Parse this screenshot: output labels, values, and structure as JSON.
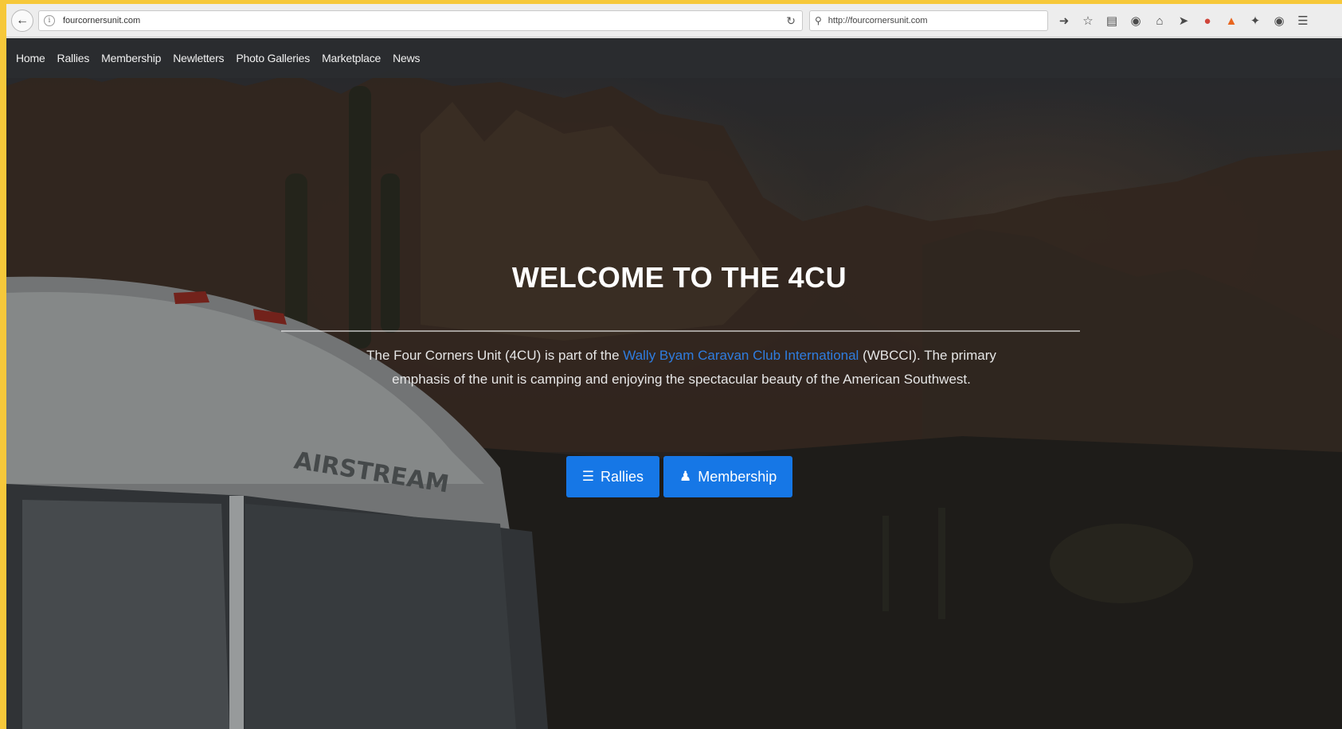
{
  "browser": {
    "url": "fourcornersunit.com",
    "search_text": "http://fourcornersunit.com",
    "icons": [
      "back-icon",
      "info-icon",
      "reload-icon",
      "search-icon",
      "arrow-right-icon",
      "star-icon",
      "reading-list-icon",
      "pocket-icon",
      "home-icon",
      "send-icon",
      "extension-icon",
      "flame-icon",
      "plane-icon",
      "shield-icon",
      "menu-icon"
    ]
  },
  "nav": {
    "items": [
      "Home",
      "Rallies",
      "Membership",
      "Newletters",
      "Photo Galleries",
      "Marketplace",
      "News"
    ]
  },
  "hero": {
    "title": "WELCOME TO THE 4CU",
    "text_before_link": "The Four Corners Unit (4CU) is part of the ",
    "link_text": "Wally Byam Caravan Club International",
    "text_after_link": " (WBCCI). The primary emphasis of the unit is camping and enjoying the spectacular beauty of the American Southwest.",
    "trailer_lettering": "AIRSTREAM",
    "buttons": {
      "rallies": "Rallies",
      "membership": "Membership"
    }
  },
  "colors": {
    "button": "#1677e6",
    "link": "#2f7de0",
    "navbar": "#2a2c30",
    "page_frame": "#f6c83a"
  }
}
